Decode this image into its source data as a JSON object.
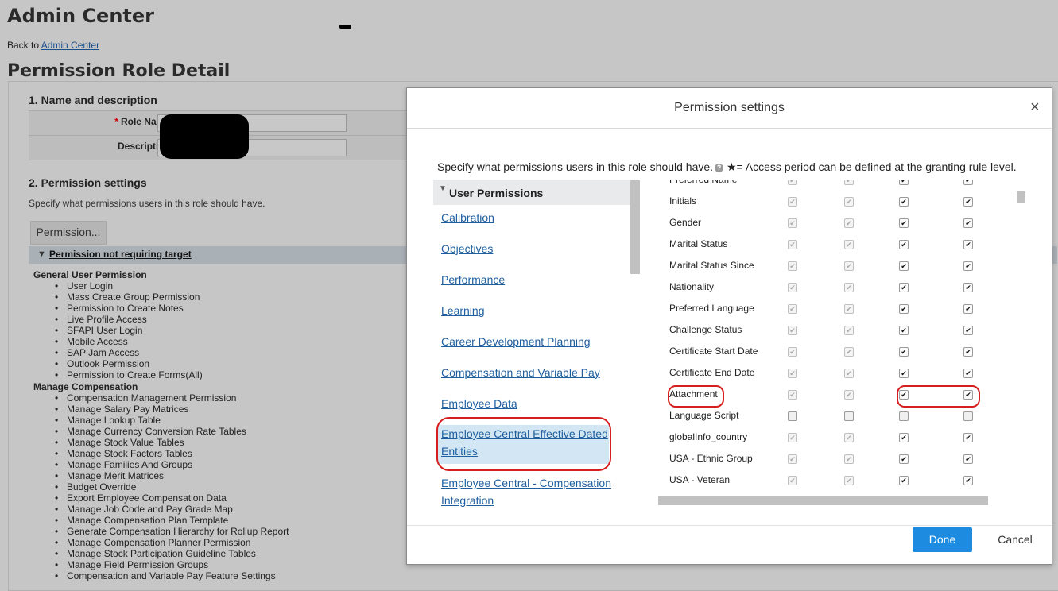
{
  "page": {
    "title": "Admin Center",
    "back_prefix": "Back to",
    "back_link": "Admin Center",
    "heading": "Permission Role Detail",
    "section1": "1. Name and description",
    "role_name_label": "Role Name:",
    "required_mark": "*",
    "description_label": "Description:",
    "section2": "2. Permission settings",
    "section2_desc": "Specify what permissions users in this role should have.",
    "permission_button": "Permission...",
    "category_toggle": "Permission not requiring target",
    "groups": [
      {
        "name": "General User Permission",
        "items": [
          "User Login",
          "Mass Create Group Permission",
          "Permission to Create Notes",
          "Live Profile Access",
          "SFAPI User Login",
          "Mobile Access",
          "SAP Jam Access",
          "Outlook Permission",
          "Permission to Create Forms(All)"
        ]
      },
      {
        "name": "Manage Compensation",
        "items": [
          "Compensation Management Permission",
          "Manage Salary Pay Matrices",
          "Manage Lookup Table",
          "Manage Currency Conversion Rate Tables",
          "Manage Stock Value Tables",
          "Manage Stock Factors Tables",
          "Manage Families And Groups",
          "Manage Merit Matrices",
          "Budget Override",
          "Export Employee Compensation Data",
          "Manage Job Code and Pay Grade Map",
          "Manage Compensation Plan Template",
          "Generate Compensation Hierarchy for Rollup Report",
          "Manage Compensation Planner Permission",
          "Manage Stock Participation Guideline Tables",
          "Manage Field Permission Groups",
          "Compensation and Variable Pay Feature Settings"
        ]
      }
    ]
  },
  "dialog": {
    "title": "Permission settings",
    "close": "×",
    "instruction": "Specify what permissions users in this role should have.",
    "help": "?",
    "access_note": "★= Access period can be defined at the granting rule level.",
    "nav_header": "User Permissions",
    "nav_items": [
      "Calibration",
      "Objectives",
      "Performance",
      "Learning",
      "Career Development Planning",
      "Compensation and Variable Pay",
      "Employee Data",
      "Employee Central Effective Dated Entities",
      "Employee Central - Compensation Integration"
    ],
    "selected_nav": "Employee Central Effective Dated Entities",
    "fields": [
      {
        "label": "Preferred Name",
        "checks": [
          "dis",
          "dis",
          "on",
          "on"
        ]
      },
      {
        "label": "Initials",
        "checks": [
          "dis",
          "dis",
          "on",
          "on"
        ]
      },
      {
        "label": "Gender",
        "checks": [
          "dis",
          "dis",
          "on",
          "on"
        ]
      },
      {
        "label": "Marital Status",
        "checks": [
          "dis",
          "dis",
          "on",
          "on"
        ]
      },
      {
        "label": "Marital Status Since",
        "checks": [
          "dis",
          "dis",
          "on",
          "on"
        ]
      },
      {
        "label": "Nationality",
        "checks": [
          "dis",
          "dis",
          "on",
          "on"
        ]
      },
      {
        "label": "Preferred Language",
        "checks": [
          "dis",
          "dis",
          "on",
          "on"
        ]
      },
      {
        "label": "Challenge Status",
        "checks": [
          "dis",
          "dis",
          "on",
          "on"
        ]
      },
      {
        "label": "Certificate Start Date",
        "checks": [
          "dis",
          "dis",
          "on",
          "on"
        ]
      },
      {
        "label": "Certificate End Date",
        "checks": [
          "dis",
          "dis",
          "on",
          "on"
        ]
      },
      {
        "label": "Attachment",
        "checks": [
          "dis",
          "dis",
          "on",
          "on"
        ]
      },
      {
        "label": "Language Script",
        "checks": [
          "off",
          "off",
          "offdis",
          "off"
        ]
      },
      {
        "label": "globalInfo_country",
        "checks": [
          "dis",
          "dis",
          "on",
          "on"
        ]
      },
      {
        "label": "USA - Ethnic Group",
        "checks": [
          "dis",
          "dis",
          "on",
          "on"
        ]
      },
      {
        "label": "USA - Veteran",
        "checks": [
          "dis",
          "dis",
          "on",
          "on"
        ]
      }
    ],
    "check_glyph": "✔",
    "done": "Done",
    "cancel": "Cancel"
  },
  "colors": {
    "accent": "#1d8ce0",
    "link": "#1f5f9f",
    "highlight": "#d61e1e",
    "selected_bg": "#d2e7f3"
  }
}
